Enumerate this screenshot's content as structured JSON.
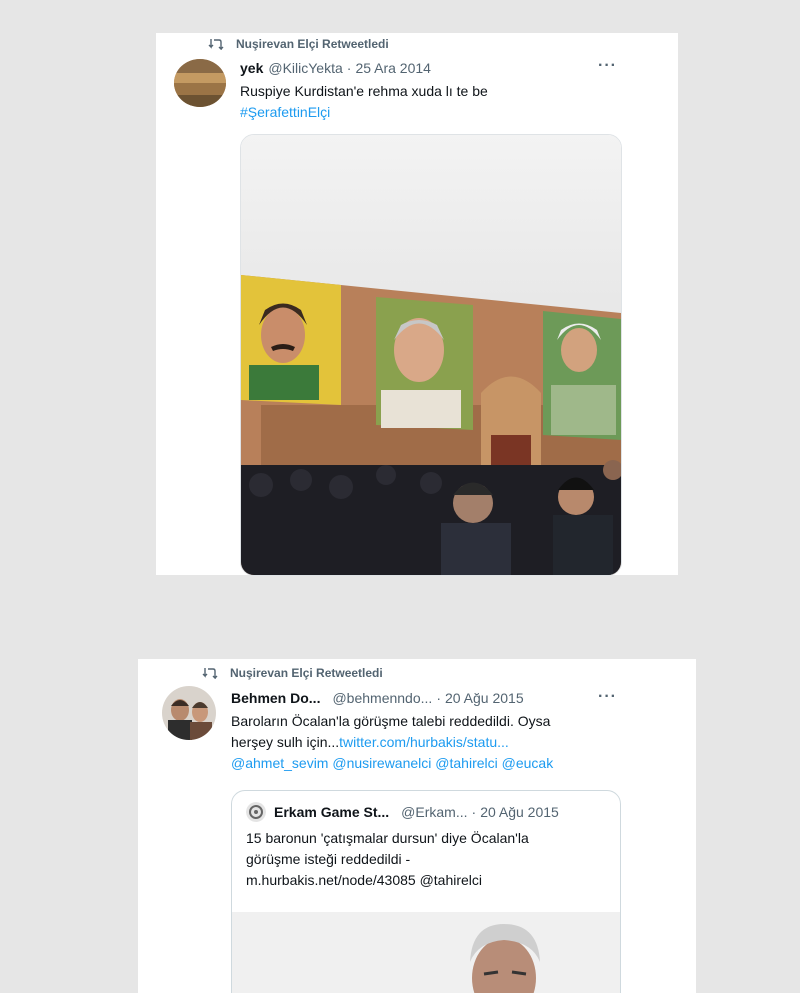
{
  "tweet1": {
    "retweet_label": "Nuşirevan Elçi Retweetledi",
    "name": "yek",
    "handle": "@KilicYekta",
    "separator": "·",
    "date": "25 Ara 2014",
    "more": "···",
    "text": "Ruspiye Kurdistan'e rehma xuda lı te be",
    "hashtag": "#ŞerafettinElçi",
    "icons": {
      "retweet": "retweet-icon",
      "more": "more-icon"
    }
  },
  "tweet2": {
    "retweet_label": "Nuşirevan Elçi Retweetledi",
    "name": "Behmen Do...",
    "handle": "@behmenndo...",
    "separator": "·",
    "date": "20 Ağu 2015",
    "more": "···",
    "text_line1": "Baroların Öcalan'la görüşme talebi reddedildi. Oysa",
    "text_line2_plain": "herşey sulh için...",
    "text_line2_link": "twitter.com/hurbakis/statu...",
    "mentions": "@ahmet_sevim @nusirewanelci @tahirelci @eucak",
    "quote": {
      "name": "Erkam Game St...",
      "handle": "@Erkam...",
      "separator": "·",
      "date": "20 Ağu 2015",
      "line1": "15 baronun 'çatışmalar dursun' diye Öcalan'la",
      "line2": "görüşme isteği reddedildi  -",
      "line3": "m.hurbakis.net/node/43085 @tahirelci"
    }
  },
  "colors": {
    "background": "#e6e6e6",
    "card": "#ffffff",
    "link": "#1d9bf0",
    "secondary_text": "#536471",
    "primary_text": "#0f1419"
  }
}
